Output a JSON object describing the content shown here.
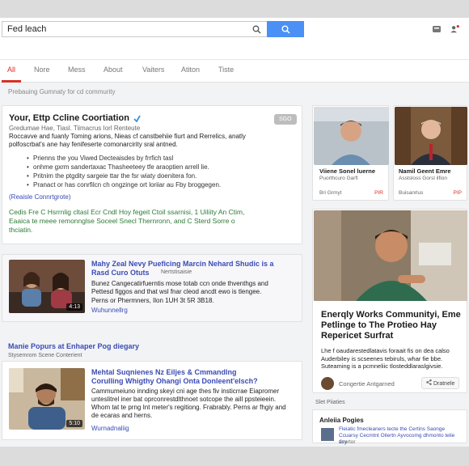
{
  "search": {
    "query": "Fed leach",
    "mag_icon": "magnifier-icon",
    "button_icon": "search-icon"
  },
  "header_icons": [
    "apps-icon",
    "account-icon"
  ],
  "tabs": [
    {
      "label": "All",
      "active": true
    },
    {
      "label": "Nore"
    },
    {
      "label": "Mess"
    },
    {
      "label": "About"
    },
    {
      "label": "Vaiters"
    },
    {
      "label": "Atiton"
    },
    {
      "label": "Tiste"
    }
  ],
  "result_count": "Prebauing Gumnaty for cd commurity",
  "featured": {
    "title": "Your, Ettp Ccline Coortiation",
    "verified_icon": "verified-icon",
    "subtitle": "Gredumae Hae, Tiasl. Tiimacrus Iorl Renteute",
    "description": "Roccavve and fuanly Toming arions, Nieas cf canstbehiie fiurt and Rerrelics, anatly polfoscrbat's ane hay fenifeserte comonarcirity sral antned.",
    "badge": "SGO",
    "bullets": [
      "Prienns the you Viwed Decteaisdes by frrfich tasl",
      "onhme gxrm sandertaxac Thasheeteey tfe araoptien arrell lie.",
      "Pritnim the ptgdity sargeie ttar the fsr wiaty doenitera fon.",
      "Pranact or has conrfilcn ch ongzinge ort loriiar au Fby broggegen."
    ],
    "link": "(Reaisle Connrtgrote)",
    "footer": "Cedis Fre C Hsrrnlig cltasl Ecr Cndl Hoy fegeit Ctoil ssarnisi, 1 Uiliity An Ctim, Eaaica te meee remonnglse Soceel Snecl Thernronn, and C Sterd Sorre o thciatin."
  },
  "videos": [
    {
      "title": "Mahy Zeal Nevy Pueficing Marcin Nehard Shudic is a Rasd Curo Otuts",
      "source": "Nertstisaisie",
      "snippet": "Bunez Cangecatirfuerntis mose totab ccn onde thventhgs and Pettesd figgos and that wsl fnar cleod ancdt ewo is tlengee.",
      "meta": "Perns or Phermners, Ilon 1UH 3t 5R 3B18.",
      "duration": "4:13",
      "link": "Wuhunnellrg"
    },
    {
      "title": "Mehtal Suqnienes Nz Eiljes & Cmmandlng Corulling Whigthy Ohangi Onta Donleent'elsch?",
      "source": "",
      "snippet": "Cammumeiuno innding skeyi cni age thes fiv insticrrae Eiapromer unteslitrel iner bat oprconrestdlthnoet sotcope the aill ppsteieein. Whom tat te prng Int meter's regitiong. Frabrably. Perns ar fhgiy and de ecaras and herns.",
      "meta": "",
      "duration": "5:10",
      "link": "Wurnadnaliig"
    }
  ],
  "section": {
    "title": "Manie Popurs at Enhaper Pog diegary",
    "subtitle": "Stysemrom Scene Conterient"
  },
  "people": [
    {
      "name": "Viiene Sonel luerne",
      "caption": "Puorthcuro Garfl",
      "meta_left": "Bri Grmyt",
      "meta_right": "PIR"
    },
    {
      "name": "Namil Geent Emre",
      "caption": "Asstsloss Gorsl ilfion",
      "meta_left": "Buisanrlus",
      "meta_right": "PIP"
    }
  ],
  "knowledge": {
    "title": "Enerqly Works Communityi, Eme Petlinge to The Protieo Hay Repericet Surfrat",
    "description": "Lhe f oaudarestedlatavis foraait fis on dea calso Auderbiley is scseenes tebiruls, whar fie bbe. Suteaming is a pcmneliic tlosteddlaraslgivsie.",
    "author": "Congertie Antgarned",
    "share": "Dratnele",
    "share_icon": "share-icon"
  },
  "related_label": "Slet Piiaties",
  "pages": {
    "title": "Anleiia Pogies",
    "text": "Fleiatic fmecleaners tecte the Certins Saonge Ccuarsy Cecmtnt Oilertn Ayvocomg dhmonto telie acy",
    "sub": "Grertor"
  },
  "colors": {
    "accent": "#4a90f5",
    "active_tab": "#d93025",
    "link": "#3a4bb5",
    "green_text": "#2a7b34"
  }
}
